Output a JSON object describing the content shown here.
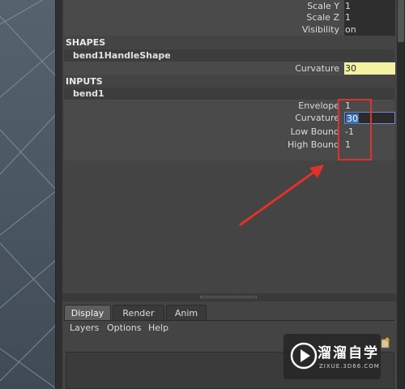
{
  "channel_box": {
    "top_attributes": [
      {
        "label": "Scale Y",
        "value": "1"
      },
      {
        "label": "Scale Z",
        "value": "1"
      },
      {
        "label": "Visibility",
        "value": "on"
      }
    ],
    "shapes_title": "SHAPES",
    "shape_node": "bend1HandleShape",
    "shape_attributes": [
      {
        "label": "Curvature",
        "value": "30"
      }
    ],
    "inputs_title": "INPUTS",
    "input_node": "bend1",
    "input_attributes": [
      {
        "label": "Envelope",
        "value": "1"
      },
      {
        "label": "Curvature",
        "value": "30"
      },
      {
        "label": "Low Bound",
        "value": "-1"
      },
      {
        "label": "High Bound",
        "value": "1"
      }
    ]
  },
  "layer_editor": {
    "tabs": [
      {
        "label": "Display",
        "active": true
      },
      {
        "label": "Render",
        "active": false
      },
      {
        "label": "Anim",
        "active": false
      }
    ],
    "menu": [
      "Layers",
      "Options",
      "Help"
    ]
  },
  "watermark": {
    "title": "溜溜自学",
    "url": "ZIXUE.3D66.COM"
  },
  "colors": {
    "highlight": "#f3f1a4",
    "annotation": "#e0312a",
    "selection": "#3c6fb5"
  }
}
